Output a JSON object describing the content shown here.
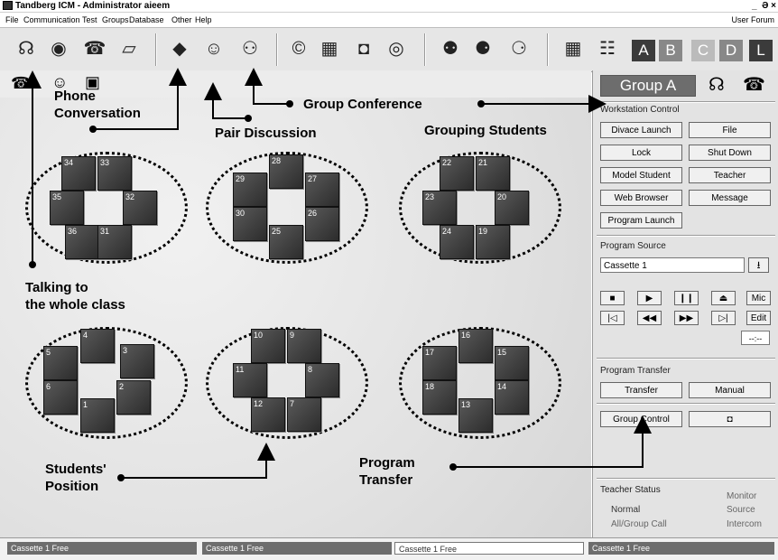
{
  "window": {
    "title": "Tandberg ICM - Administrator aieem",
    "controls": "_  Ə ×"
  },
  "menu": {
    "items": [
      "File",
      "Communication",
      "Test",
      "Groups",
      "Database",
      "Other",
      "Help"
    ],
    "right": "User Forum"
  },
  "toolbar": {
    "icons": [
      "headset-icon",
      "speaker-icon",
      "phone-icon",
      "notebook-icon",
      "eye-icon",
      "person-icon",
      "persons-icon",
      "copyright-icon",
      "network-icon",
      "lock-icon",
      "chat-icon",
      "pair-icon",
      "group-icon",
      "group-transfer-icon",
      "grid-icon",
      "keypad-icon"
    ],
    "group_buttons": [
      "A",
      "B",
      "C",
      "D",
      "L"
    ],
    "group_colors": [
      "#3b3b3b",
      "#888888",
      "#bbbbbb",
      "#888888",
      "#3b3b3b"
    ]
  },
  "annotations": {
    "phone_conversation": [
      "Phone",
      "Conversation"
    ],
    "group_conference": "Group Conference",
    "pair_discussion": "Pair Discussion",
    "grouping_students": "Grouping Students",
    "talking_whole_class": [
      "Talking to",
      "the whole class"
    ],
    "students_position": [
      "Students'",
      "Position"
    ],
    "program_transfer": [
      "Program",
      "Transfer"
    ]
  },
  "seats": {
    "g1": [
      "34",
      "33",
      "35",
      "32",
      "36",
      "31"
    ],
    "g2": [
      "28",
      "29",
      "27",
      "30",
      "26",
      "25"
    ],
    "g3": [
      "22",
      "21",
      "23",
      "20",
      "24",
      "19"
    ],
    "g4": [
      "4",
      "5",
      "3",
      "6",
      "2",
      "1"
    ],
    "g5": [
      "10",
      "9",
      "11",
      "8",
      "12",
      "7"
    ],
    "g6": [
      "16",
      "17",
      "15",
      "18",
      "14",
      "13"
    ]
  },
  "panel": {
    "group_title": "Group A",
    "workstation_control": {
      "header": "Workstation Control",
      "buttons": [
        "Divace Launch",
        "File",
        "Lock",
        "Shut Down",
        "Model Student",
        "Teacher",
        "Web Browser",
        "Message",
        "Program Launch"
      ]
    },
    "program_source": {
      "header": "Program Source",
      "selected": "Cassette 1",
      "controls": [
        "■",
        "▶",
        "❙❙",
        "⏏",
        "Mic",
        "|◁",
        "◀◀",
        "▶▶",
        "▷|",
        "Edit"
      ],
      "counter": "--:--"
    },
    "program_transfer": {
      "header": "Program Transfer",
      "transfer": "Transfer",
      "manual": "Manual",
      "group_control": "Group Control"
    },
    "teacher_status": {
      "header": "Teacher Status",
      "col1": [
        "Normal",
        "All/Group Call"
      ],
      "col2": [
        "Monitor",
        "Source",
        "Intercom"
      ]
    }
  },
  "statusbar": {
    "slots": [
      "Cassette 1  Free",
      "Cassette 1  Free",
      "Cassette 1  Free",
      "Cassette 1  Free"
    ],
    "colors": [
      "#6d6d6d",
      "#6d6d6d",
      "#ffffff",
      "#6d6d6d"
    ]
  }
}
